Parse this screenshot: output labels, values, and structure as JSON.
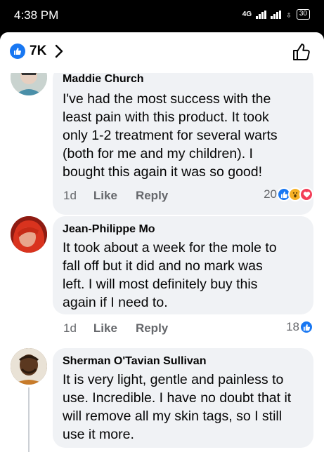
{
  "status": {
    "time": "4:38 PM",
    "network": "4G",
    "battery": "30"
  },
  "header": {
    "reaction_count": "7K"
  },
  "comments": [
    {
      "author": "Maddie Church",
      "lines": [
        "I've had the most success with the",
        "least pain with this product. It took",
        "only 1-2 treatment for several warts",
        "(both for me and my children). I",
        "bought this again it was so good!"
      ],
      "time": "1d",
      "like_label": "Like",
      "reply_label": "Reply",
      "reaction_count": "20",
      "reactions": [
        "like-icon",
        "wow-icon",
        "love-icon"
      ]
    },
    {
      "author": "Jean-Philippe Mo",
      "lines": [
        "It took about a week for the mole to",
        "fall off but it did and no mark was",
        "left. I will most definitely buy this",
        "again if I need to."
      ],
      "time": "1d",
      "like_label": "Like",
      "reply_label": "Reply",
      "reaction_count": "18",
      "reactions": [
        "like-icon"
      ]
    },
    {
      "author": "Sherman O'Tavian Sullivan",
      "lines": [
        "It is very light, gentle and painless to",
        "use. Incredible. I have no doubt that it",
        "will remove all my skin tags, so I still",
        "use it more."
      ]
    }
  ],
  "colors": {
    "like_blue": "#1877f2",
    "love_red": "#f33e58",
    "wow_yellow": "#f7b125",
    "bubble_bg": "#f0f2f5"
  }
}
